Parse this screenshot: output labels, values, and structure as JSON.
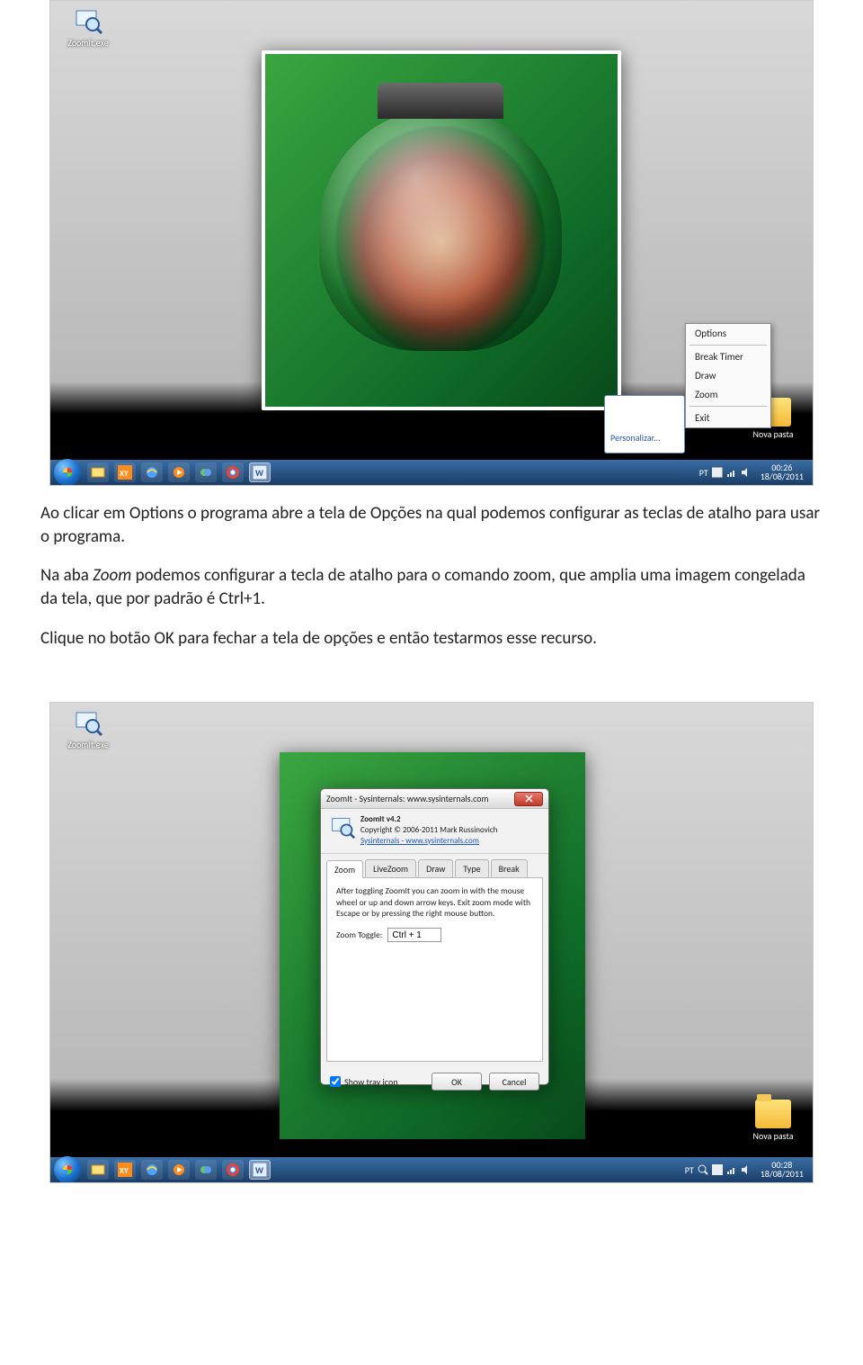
{
  "desktop_icons": {
    "zoomit_label": "ZoomIt.exe",
    "folder_label": "Nova pasta"
  },
  "context_menu": {
    "options": "Options",
    "break_timer": "Break Timer",
    "draw": "Draw",
    "zoom": "Zoom",
    "exit": "Exit"
  },
  "popup_behind": {
    "link": "Personalizar..."
  },
  "taskbar": {
    "lang": "PT",
    "clock_time_1": "00:26",
    "clock_date_1": "18/08/2011",
    "clock_time_2": "00:28",
    "clock_date_2": "18/08/2011"
  },
  "body_text": {
    "p1": "Ao clicar em Options o programa abre a tela de Opções na qual podemos configurar as teclas de atalho para usar o programa.",
    "p2_a": "Na aba ",
    "p2_it": "Zoom",
    "p2_b": " podemos configurar a tecla de atalho para o comando zoom, que amplia uma imagem congelada da tela, que por padrão é Ctrl+1.",
    "p3": "Clique no botão OK para fechar a tela de opções e então testarmos esse recurso."
  },
  "dialog": {
    "title": "ZoomIt - Sysinternals: www.sysinternals.com",
    "app_name": "ZoomIt v4.2",
    "copyright": "Copyright © 2006-2011 Mark Russinovich",
    "link": "Sysinternals - www.sysinternals.com",
    "tabs": {
      "zoom": "Zoom",
      "livezoom": "LiveZoom",
      "draw": "Draw",
      "type": "Type",
      "break": "Break"
    },
    "zoom_desc": "After toggling ZoomIt you can zoom in with the mouse wheel or up and down arrow keys. Exit zoom mode with Escape or by pressing the right mouse button.",
    "zoom_toggle_label": "Zoom Toggle:",
    "zoom_toggle_value": "Ctrl + 1",
    "show_tray_icon": "Show tray icon",
    "ok": "OK",
    "cancel": "Cancel"
  }
}
